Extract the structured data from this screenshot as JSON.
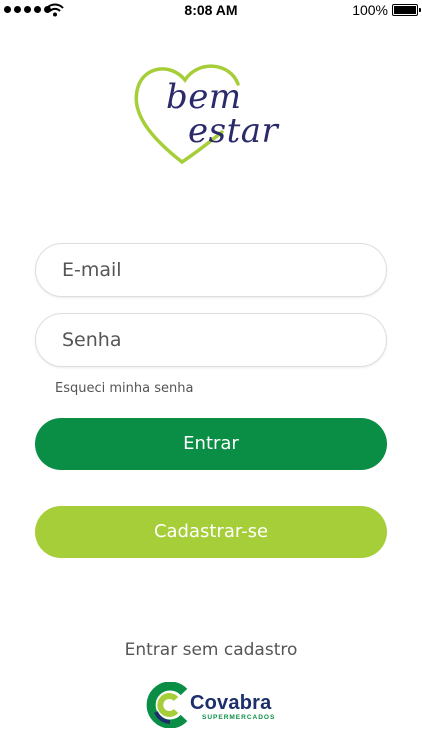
{
  "status_bar": {
    "time": "8:08 AM",
    "battery": "100%",
    "icons": [
      "signal-dots-icon",
      "wifi-icon",
      "battery-icon"
    ]
  },
  "logo": {
    "line1": "bem",
    "line2": "estar",
    "heart_color": "#a6ce39",
    "text_color": "#2b2a6a"
  },
  "login": {
    "email_placeholder": "E-mail",
    "password_placeholder": "Senha",
    "forgot_label": "Esqueci minha senha",
    "enter_label": "Entrar",
    "signup_label": "Cadastrar-se",
    "guest_label": "Entrar sem cadastro"
  },
  "brand": {
    "name": "Covabra",
    "subtitle": "SUPERMERCADOS"
  },
  "colors": {
    "primary": "#0a8e45",
    "secondary": "#a6ce39",
    "navy": "#1c2f6b"
  }
}
